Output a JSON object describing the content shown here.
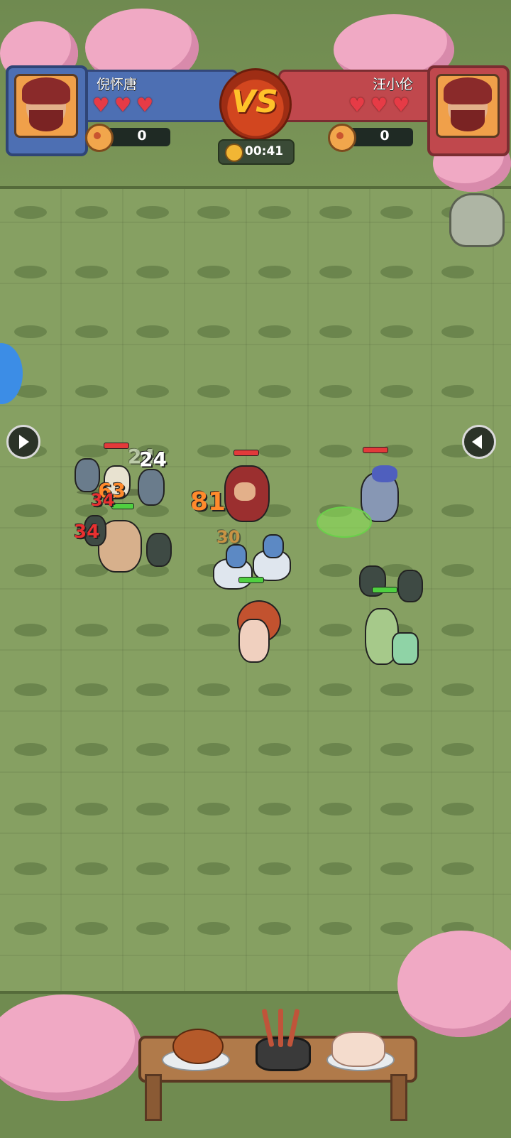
{
  "player_left": {
    "name": "倪怀唐",
    "lives": 3,
    "coins": "0",
    "team_color": "#4d6fb3"
  },
  "player_right": {
    "name": "汪小伦",
    "lives": 3,
    "coins": "0",
    "team_color": "#c0484d"
  },
  "vs_label": "VS",
  "timer": "00:41",
  "damage_numbers": [
    "24",
    "24",
    "63",
    "34",
    "34",
    "81",
    "30"
  ],
  "colors": {
    "grass": "#86a062",
    "blossom": "#f0a9c4",
    "damage_orange": "#ff8a2c",
    "damage_red": "#e83030",
    "hp_enemy": "#e23a3a",
    "hp_ally": "#4fd040"
  },
  "icons": {
    "coin": "coin-pouch-icon",
    "timer": "stopwatch-icon",
    "heart": "heart-icon",
    "left_arrow": "chevron-right-icon",
    "right_arrow": "chevron-left-icon"
  }
}
